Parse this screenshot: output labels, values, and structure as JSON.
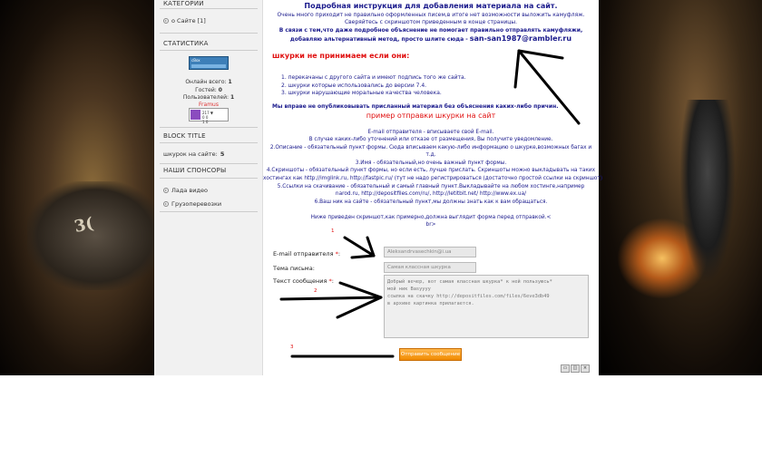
{
  "sidebar": {
    "categories_title": "КАТЕГОРИИ",
    "categories_item": "о Сайте [1]",
    "stats_title": "СТАТИСТИКА",
    "stats_widget_label": "cBox",
    "online_total_label": "Онлайн всего:",
    "online_total_value": "1",
    "guests_label": "Гостей:",
    "guests_value": "0",
    "users_label": "Пользователей:",
    "users_value": "1",
    "online_user": "Framus",
    "counter_text": "217 ▼\n0 0\n1 0",
    "block_title": "BLOCK TITLE",
    "skins_label": "шкурок на сайте:",
    "skins_value": "5",
    "sponsors_title": "НАШИ СПОНСОРЫ",
    "sponsor_1": "Лада видео",
    "sponsor_2": "Грузоперевозки"
  },
  "main": {
    "heading": "Подробная инструкция для добавления материала на сайт.",
    "intro_1": "Очень много приходит не правильно оформленных писем,в итоге нет возможности выложить камуфляж.",
    "intro_2": "Сверяйтесь с скриншотом приведенным в конце страницы.",
    "alt_1": "В связи с тем,что даже подробное объяснение не помогает правильно отправлять камуфляжи,",
    "alt_2": "добавляю альтернативный метод, просто шлите сюда -",
    "email": "san-san1987@rambler.ru",
    "reject_title": "шкурки не принимаем если они:",
    "reject_items": [
      "1.  перекачаны с другого сайта и имеют подпись того же сайта.",
      "2.  шкурки которые использовались до версии 7.4.",
      "3.  шкурки нарушающие моральные качества человека."
    ],
    "rights_note": "Мы вправе не опубликовывать присланный материал без объяснения каких-либо причин.",
    "example_title": "пример отправки шкурки на сайт",
    "rules": [
      "E-mail отправителя - вписываете свой E-mail.",
      "В случае каких-либо уточнений или отказе от размещения, Вы получите уведомление.",
      "2.Описание - обязательный пункт формы. Сюда вписываем какую-либо информацию о шкурке,возможных багах и",
      "т.д.",
      "3.Имя - обязательный,но очень важный пункт формы.",
      "4.Скриншоты - обязательный пункт формы, но если есть, лучше прислать. Скриншоты можно выкладывать на таких",
      "хостингах как http://imglink.ru, http://fastpic.ru/ (тут не надо регистрироваться (достаточно простой ссылки на скриншот)",
      "5.Ссылки на скачивание - обязательный и самый главный пункт.Выкладывайте на любом хостинге,например",
      "narod.ru, http://depositfiles.com/ru/, http://letitbit.net/ http://www.ex.ua/",
      "6.Ваш ник на сайте - обязательный пункт,мы должны знать как к вам обращаться."
    ],
    "screenshot_note_1": "Ниже приведен скриншот,как примерно,должна выглядит форма перед отправкой.<",
    "screenshot_note_2": "br>",
    "form": {
      "email_label": "E-mail отправителя",
      "email_value": "Aleksandrvasechkin@i.ua",
      "subject_label": "Тема письма:",
      "subject_value": "Самая классная шкурка",
      "message_label": "Текст сообщения",
      "message_value": "Добрый вечер, вот самая классная шкурка* к ней пользуюсь*\nмой ник Вasyyyy\nссылка на скачку http://depositfiles.com/files/6eve3db49\nв архиве картинка прилагается.",
      "send_label": "Отправить сообщение",
      "marker_1": "1",
      "marker_2": "2",
      "marker_3": "3"
    }
  },
  "colors": {
    "navy": "#1a1a8c",
    "red": "#e01010",
    "button": "#f08a00"
  }
}
